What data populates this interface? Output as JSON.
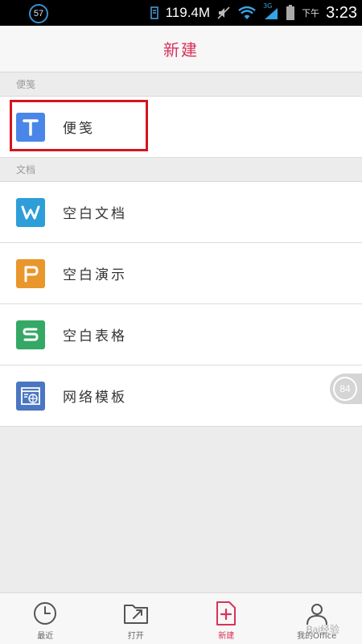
{
  "status_bar": {
    "notification_count": "57",
    "speed": "119.4M",
    "network_type": "3G",
    "ampm": "下午",
    "time": "3:23",
    "icons": [
      "speed-meter-icon",
      "mute-icon",
      "wifi-icon",
      "signal-icon",
      "battery-icon"
    ]
  },
  "header": {
    "title": "新建"
  },
  "sections": {
    "notes": {
      "label": "便笺"
    },
    "documents": {
      "label": "文档"
    }
  },
  "items": {
    "note": {
      "label": "便笺",
      "icon": "note-icon",
      "color": "#4a86e8",
      "glyph": "T"
    },
    "doc": {
      "label": "空白文档",
      "icon": "word-doc-icon",
      "color": "#2e9ed8",
      "glyph": "W"
    },
    "presentation": {
      "label": "空白演示",
      "icon": "presentation-icon",
      "color": "#e9962b",
      "glyph": "P"
    },
    "spreadsheet": {
      "label": "空白表格",
      "icon": "spreadsheet-icon",
      "color": "#35a866",
      "glyph": "S"
    },
    "template": {
      "label": "网络模板",
      "icon": "web-template-icon",
      "color": "#4a76c2"
    }
  },
  "float_badge": {
    "value": "84"
  },
  "bottom_nav": {
    "recent": "最近",
    "open": "打开",
    "new": "新建",
    "my_office": "我的Office",
    "active": "new"
  },
  "watermark": "Bai经验"
}
